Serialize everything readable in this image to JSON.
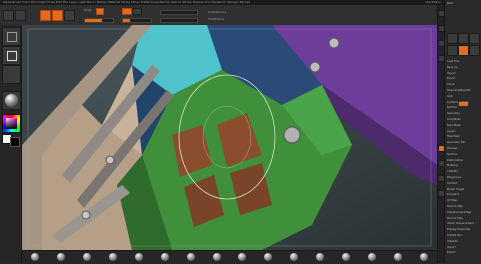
{
  "menubar": {
    "items": [
      "Alpha",
      "Brush",
      "Color",
      "Document",
      "Draw",
      "Edit",
      "File",
      "Layer",
      "Light",
      "Macro",
      "Marker",
      "Material",
      "Movie",
      "Picker",
      "Preferences",
      "Render",
      "Stencil",
      "Stroke",
      "Texture",
      "Tool",
      "Transform",
      "Zplugin",
      "Zscript"
    ],
    "right_label": "QuickSave"
  },
  "toolbar": {
    "labels": [
      "Edit",
      "Draw",
      "Move",
      "Scale",
      "Rotate",
      "Mrgb",
      "Rgb",
      "M",
      "Zadd",
      "Zsub",
      "Focal Shift 0",
      "Draw Size 64",
      "Z Intensity 25",
      "ActivePoints",
      "TotalPoints"
    ],
    "rgb_intensity": 0.6,
    "z_intensity": 0.25
  },
  "left_shelf": {
    "buttons": [
      "Brush",
      "Stroke",
      "Alpha",
      "Texture",
      "Material",
      "Color"
    ]
  },
  "bottom_bar": {
    "materials": [
      "Mat1",
      "Mat2",
      "Mat3",
      "Mat4",
      "Mat5",
      "Mat6",
      "Mat7",
      "Mat8",
      "Mat9",
      "Mat10",
      "Mat11",
      "Mat12",
      "Mat13",
      "Mat14",
      "Mat15",
      "Mat16"
    ]
  },
  "right_panel": {
    "title": "Tool",
    "items": [
      "Load Tool",
      "Save As",
      "Import",
      "Export",
      "Clone",
      "Make PolyMesh3D",
      "GoZ",
      "Lightbox > Tools",
      "SubTool",
      "Geometry",
      "ArrayMesh",
      "NanoMesh",
      "Layers",
      "FiberMesh",
      "Geometry HD",
      "Preview",
      "Surface",
      "Deformation",
      "Masking",
      "Visibility",
      "Polygroups",
      "Contact",
      "Morph Target",
      "Polypaint",
      "UV Map",
      "Texture Map",
      "Displacement Map",
      "Normal Map",
      "Vector Displacement",
      "Display Properties",
      "Unified Skin",
      "Initialize",
      "Import",
      "Export"
    ]
  },
  "colors": {
    "accent": "#e56a1f",
    "panel_bg": "#2a2a2a"
  }
}
